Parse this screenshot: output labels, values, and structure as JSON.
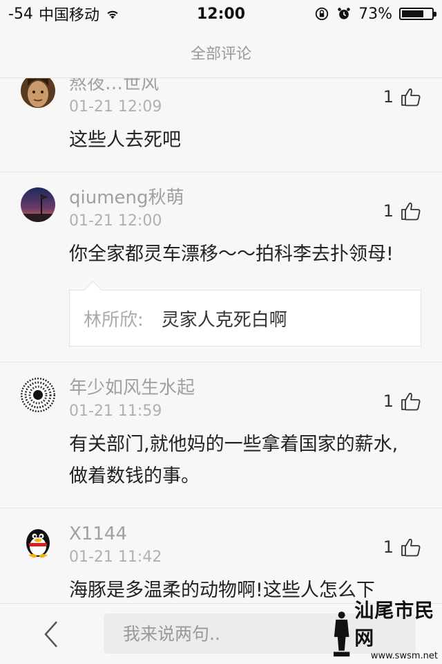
{
  "status_bar": {
    "signal": "-54",
    "carrier": "中国移动",
    "time": "12:00",
    "battery": "73%",
    "battery_level": 0.73
  },
  "header": {
    "title": "全部评论"
  },
  "comments": [
    {
      "username": "熬夜…世风",
      "time": "01-21 12:09",
      "text": "这些人去死吧",
      "likes": "1",
      "avatar": "portrait-avatar"
    },
    {
      "username": "qiumeng秋萌",
      "time": "01-21 12:00",
      "text": "你全家都灵车漂移～～拍科李去扑领母!",
      "likes": "1",
      "avatar": "sunset-avatar",
      "reply": {
        "author": "林所欣:",
        "text": "灵家人克死白啊"
      }
    },
    {
      "username": "年少如风生水起",
      "time": "01-21 11:59",
      "text": "有关部门,就他妈的一些拿着国家的薪水,做着数钱的事。",
      "likes": "1",
      "avatar": "spiral-avatar"
    },
    {
      "username": "X1144",
      "time": "01-21 11:42",
      "text": "海豚是多温柔的动物啊!这些人怎么下",
      "likes": "1",
      "avatar": "qq-penguin-avatar"
    }
  ],
  "bottom_bar": {
    "input_placeholder": "我来说两句..",
    "back_icon": "back-chevron-icon"
  },
  "watermark": {
    "title": "汕尾市民网",
    "url": "www.swsm.net"
  }
}
